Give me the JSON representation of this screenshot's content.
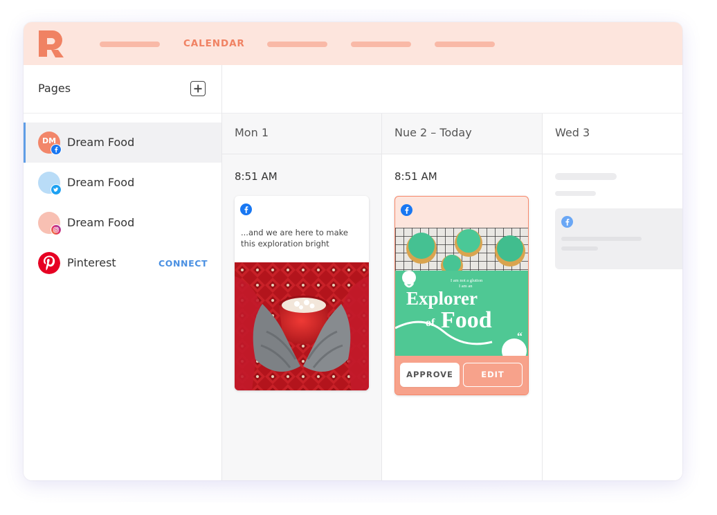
{
  "nav": {
    "active_label": "CALENDAR"
  },
  "sidebar": {
    "title": "Pages",
    "items": [
      {
        "label": "Dream Food",
        "avatar_text": "DM",
        "network": "facebook",
        "avatar_color": "#f2866a",
        "active": true
      },
      {
        "label": "Dream Food",
        "avatar_text": "",
        "network": "twitter",
        "avatar_color": "#b9dcf7",
        "active": false
      },
      {
        "label": "Dream Food",
        "avatar_text": "",
        "network": "instagram",
        "avatar_color": "#f8c0b3",
        "active": false
      },
      {
        "label": "Pinterest",
        "network": "pinterest",
        "connect_label": "CONNECT"
      }
    ]
  },
  "calendar": {
    "days": [
      {
        "header": "Mon 1",
        "time": "8:51 AM"
      },
      {
        "header": "Nue 2 – Today",
        "time": "8:51 AM"
      },
      {
        "header": "Wed 3"
      }
    ],
    "posts": [
      {
        "network": "facebook",
        "text": "...and we are here to make this exploration bright"
      },
      {
        "network": "facebook",
        "image_lines": [
          "I am not a glutton",
          "I am an"
        ],
        "image_title_1": "Explorer",
        "image_title_2a": "of",
        "image_title_2b": "Food",
        "approve_label": "APPROVE",
        "edit_label": "EDIT"
      }
    ]
  },
  "colors": {
    "brand": "#f08263",
    "topbar": "#fde5dd",
    "accent_blue": "#4a90e2",
    "facebook": "#1877f2"
  }
}
